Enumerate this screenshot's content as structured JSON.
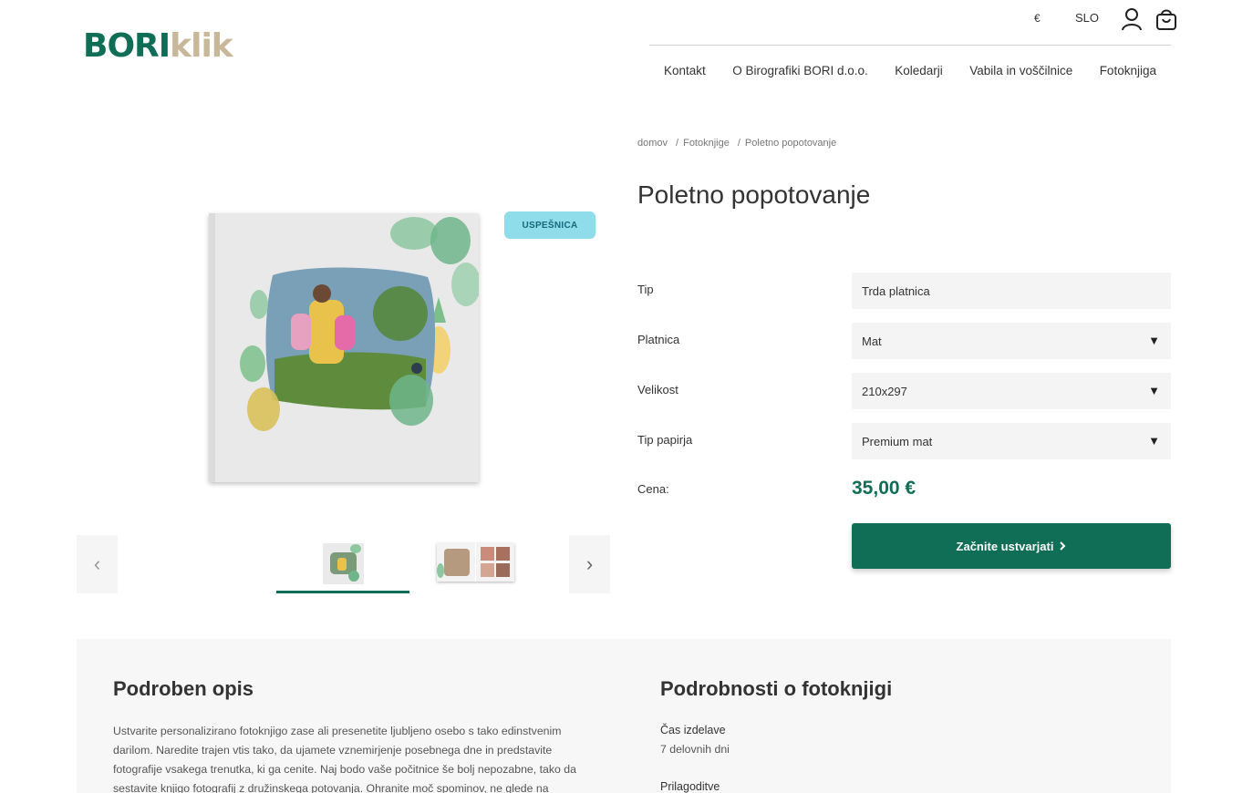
{
  "header": {
    "logo_primary": "BORI",
    "logo_secondary": "klik",
    "currency": "€",
    "language": "SLO",
    "icons": [
      "user-icon",
      "cart-icon"
    ]
  },
  "nav": {
    "items": [
      "Kontakt",
      "O Birografiki BORI d.o.o.",
      "Koledarji",
      "Vabila in voščilnice",
      "Fotoknjiga"
    ]
  },
  "breadcrumb": [
    "domov",
    "Fotoknjige",
    "Poletno popotovanje"
  ],
  "product": {
    "title": "Poletno popotovanje",
    "badge": "USPEŠNICA",
    "options": [
      {
        "label": "Tip",
        "value": "Trda platnica",
        "dropdown": false
      },
      {
        "label": "Platnica",
        "value": "Mat",
        "dropdown": true
      },
      {
        "label": "Velikost",
        "value": "210x297",
        "dropdown": true
      },
      {
        "label": "Tip papirja",
        "value": "Premium mat",
        "dropdown": true
      }
    ],
    "price_label": "Cena:",
    "price": "35,00 €",
    "cta_label": "Začnite ustvarjati",
    "caret": "▼"
  },
  "gallery": {
    "prev_icon": "‹",
    "next_icon": "›"
  },
  "description": {
    "heading": "Podroben opis",
    "text": "Ustvarite personalizirano fotoknjigo zase ali presenetite ljubljeno osebo s tako edinstvenim darilom. Naredite trajen vtis tako, da ujamete vznemirjenje posebnega dne in predstavite fotografije vsakega trenutka, ki ga cenite. Naj bodo vaše počitnice še bolj nepozabne, tako da sestavite knjigo fotografij z družinskega potovanja. Ohranite moč spominov, ne glede na"
  },
  "details": {
    "heading": "Podrobnosti o fotoknjigi",
    "production_label": "Čas izdelave",
    "production_value": "7 delovnih dni",
    "customization_label": "Prilagoditve"
  },
  "colors": {
    "brand_green": "#0f6e55",
    "brand_beige": "#c9b79a",
    "badge_bg": "#8fdcea"
  }
}
